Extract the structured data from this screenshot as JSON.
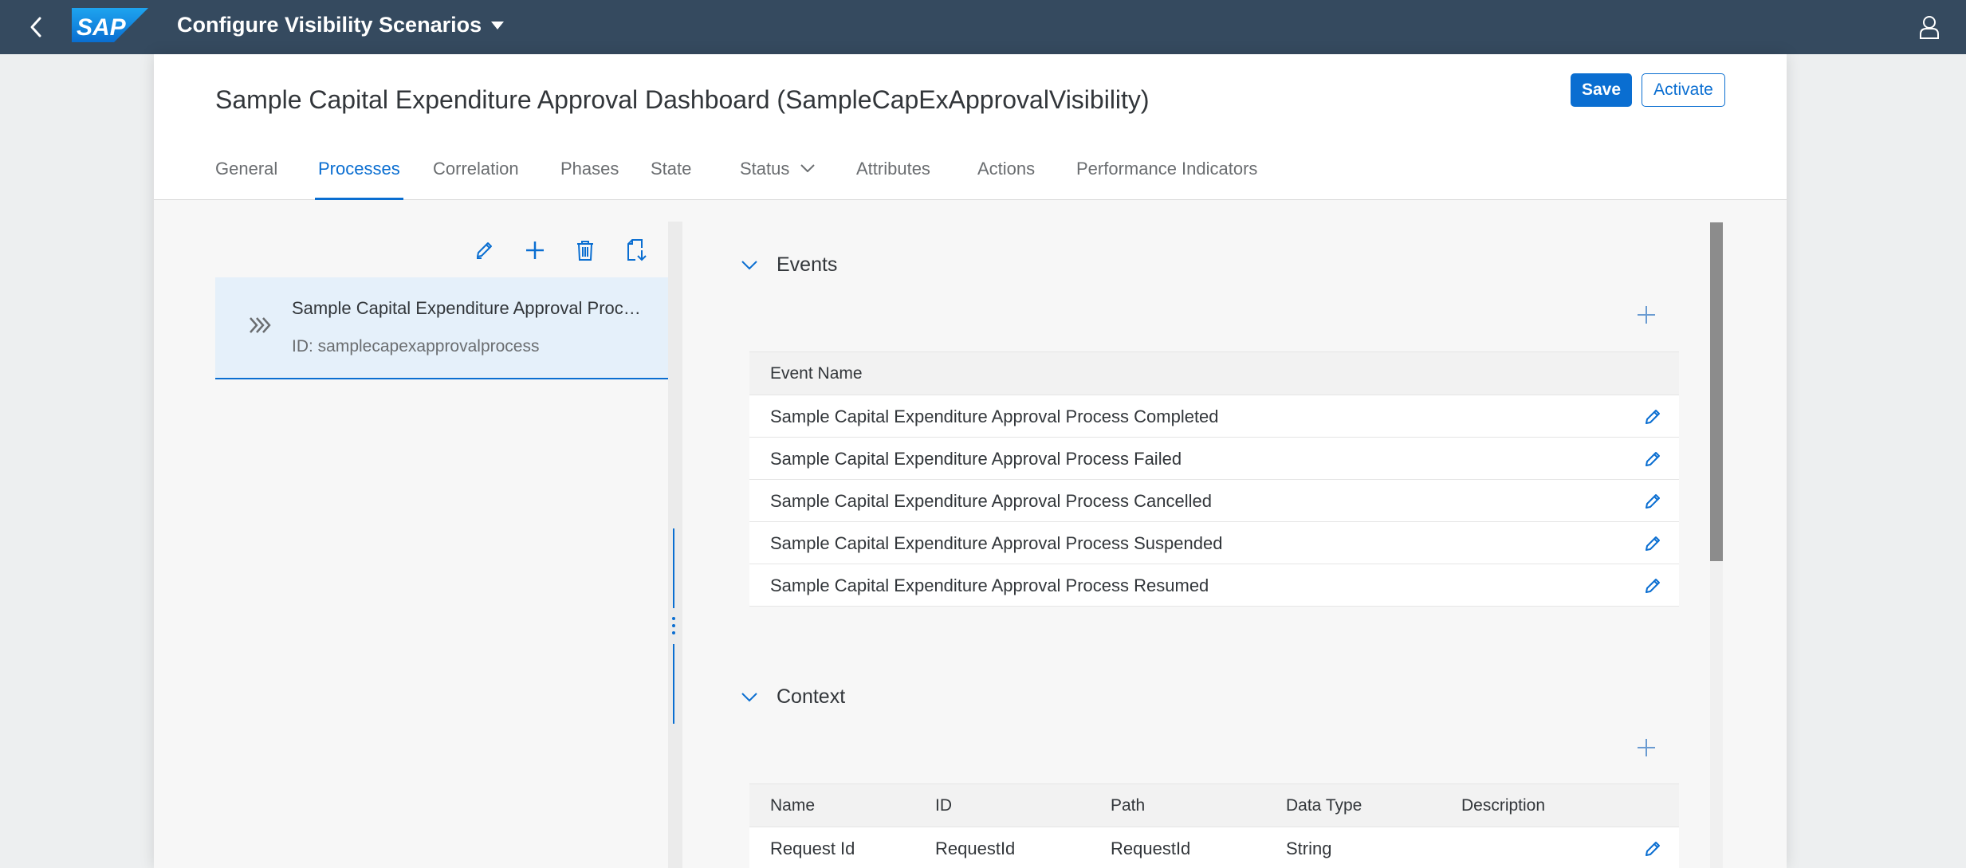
{
  "shell": {
    "title": "Configure Visibility Scenarios",
    "logo_text": "SAP",
    "icons": {
      "back": "back-icon",
      "dropdown": "triangle-down-icon",
      "user": "user-icon"
    }
  },
  "header": {
    "title": "Sample Capital Expenditure Approval Dashboard (SampleCapExApprovalVisibility)",
    "save_label": "Save",
    "activate_label": "Activate"
  },
  "tabs": [
    {
      "label": "General"
    },
    {
      "label": "Processes",
      "active": true
    },
    {
      "label": "Correlation"
    },
    {
      "label": "Phases"
    },
    {
      "label": "State"
    },
    {
      "label": "Status",
      "has_menu": true
    },
    {
      "label": "Attributes"
    },
    {
      "label": "Actions"
    },
    {
      "label": "Performance Indicators"
    }
  ],
  "left_panel": {
    "toolbar": [
      "edit-icon",
      "add-icon",
      "delete-icon",
      "import-icon"
    ],
    "process": {
      "name": "Sample Capital Expenditure Approval Process",
      "id_text": "ID: samplecapexapprovalprocess"
    }
  },
  "events": {
    "title": "Events",
    "column": "Event Name",
    "rows": [
      "Sample Capital Expenditure Approval Process Completed",
      "Sample Capital Expenditure Approval Process Failed",
      "Sample Capital Expenditure Approval Process Cancelled",
      "Sample Capital Expenditure Approval Process Suspended",
      "Sample Capital Expenditure Approval Process Resumed"
    ]
  },
  "context": {
    "title": "Context",
    "columns": [
      "Name",
      "ID",
      "Path",
      "Data Type",
      "Description"
    ],
    "rows": [
      {
        "name": "Request Id",
        "id": "RequestId",
        "path": "RequestId",
        "data_type": "String",
        "description": ""
      }
    ]
  },
  "colors": {
    "shell": "#354a5f",
    "accent": "#0a6ed1",
    "selected_item": "#e5f0fa"
  }
}
